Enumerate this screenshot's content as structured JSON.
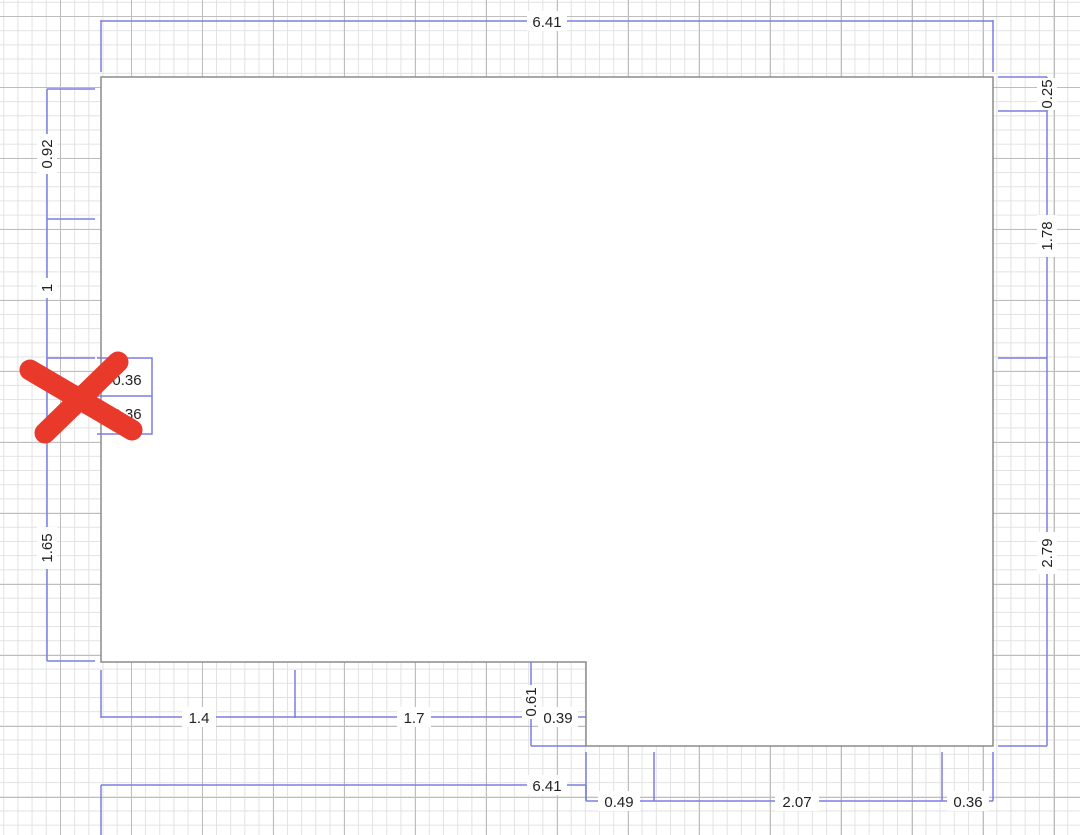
{
  "plan": {
    "dimensions": {
      "top_total": "6.41",
      "bottom_total": "6.41",
      "left_upper": "0.92",
      "left_mid": "1",
      "left_lower": "1.65",
      "notch_width": "0.36",
      "notch_height": "0.36",
      "right_top": "0.25",
      "right_upper": "1.78",
      "right_lower": "2.79",
      "bottom_left_a": "1.4",
      "bottom_left_b": "1.7",
      "step_height": "0.61",
      "step_width": "0.39",
      "bottom_right_a": "0.49",
      "bottom_right_b": "2.07",
      "bottom_right_c": "0.36"
    },
    "x_mark_color": "#e8392a"
  }
}
